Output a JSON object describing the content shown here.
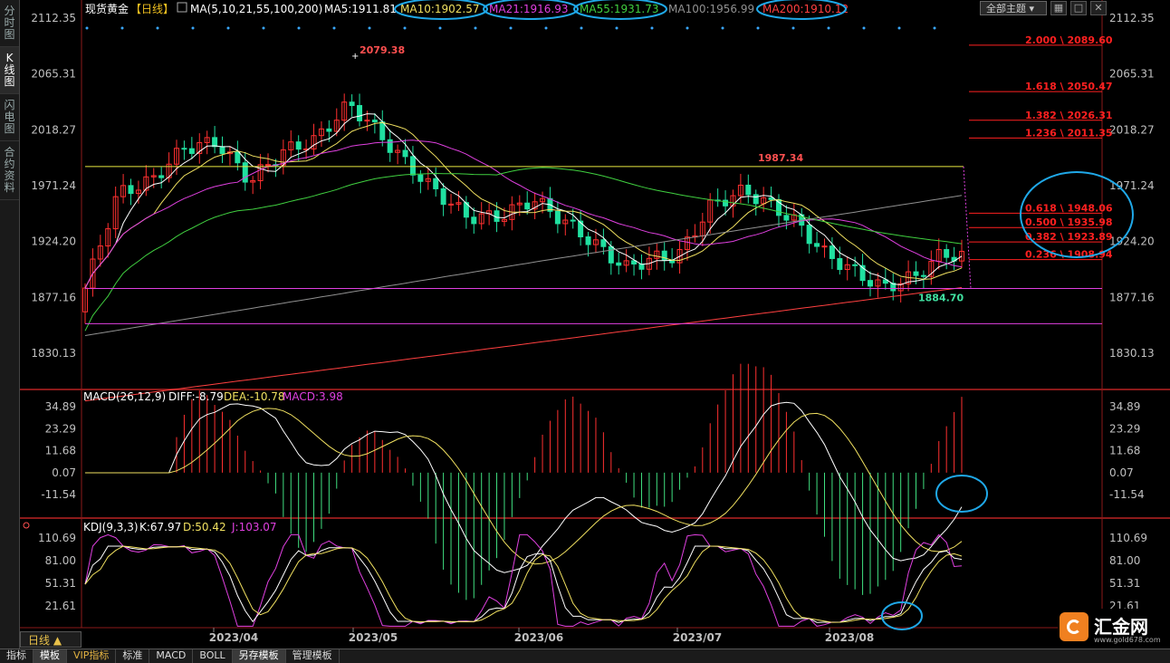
{
  "sidebar": {
    "tabs": [
      "分时图",
      "K线图",
      "闪电图",
      "合约资料"
    ],
    "active": 1
  },
  "header": {
    "symbol": "现货黄金",
    "period_tag": "【日线】",
    "ma_label": "MA(5,10,21,55,100,200)",
    "ma_values": [
      {
        "label": "MA5:1911.81",
        "color": "#ffffff",
        "highlighted": false
      },
      {
        "label": "MA10:1902.57",
        "color": "#f0e060",
        "highlighted": true
      },
      {
        "label": "MA21:1916.93",
        "color": "#e040e0",
        "highlighted": true
      },
      {
        "label": "MA55:1931.73",
        "color": "#40d040",
        "highlighted": true
      },
      {
        "label": "MA100:1956.99",
        "color": "#909090",
        "highlighted": false
      },
      {
        "label": "MA200:1910.12",
        "color": "#ff4040",
        "highlighted": true
      }
    ],
    "theme_select": "全部主题",
    "theme_icons": [
      "chevron-down-icon",
      "table-icon",
      "maximize-icon",
      "close-icon"
    ]
  },
  "price_axis": [
    "2112.35",
    "2065.31",
    "2018.27",
    "1971.24",
    "1924.20",
    "1877.16",
    "1830.13"
  ],
  "date_axis": [
    "2023/04",
    "2023/05",
    "2023/06",
    "2023/07",
    "2023/08"
  ],
  "annotations": {
    "high": "2079.38",
    "mid_high": "1987.34",
    "low": "1884.70"
  },
  "fib_levels": [
    {
      "label": "2.000 \\ 2089.60",
      "price": 2089.6
    },
    {
      "label": "1.618 \\ 2050.47",
      "price": 2050.47
    },
    {
      "label": "1.382 \\ 2026.31",
      "price": 2026.31
    },
    {
      "label": "1.236 \\ 2011.35",
      "price": 2011.35
    },
    {
      "label": "0.618 \\ 1948.06",
      "price": 1948.06
    },
    {
      "label": "0.500 \\ 1935.98",
      "price": 1935.98
    },
    {
      "label": "0.382 \\ 1923.89",
      "price": 1923.89
    },
    {
      "label": "0.236 \\ 1908.94",
      "price": 1908.94
    }
  ],
  "horizontal_lines": [
    {
      "price": 1987.34,
      "color": "#e8e840"
    },
    {
      "price": 1884.7,
      "color": "#e040e0"
    },
    {
      "price": 1855.0,
      "color": "#e040e0"
    }
  ],
  "macd": {
    "title": "MACD(26,12,9)",
    "diff": "DIFF:-8.79",
    "dea": "DEA:-10.78",
    "macd": "MACD:3.98",
    "axis": [
      "34.89",
      "23.29",
      "11.68",
      "0.07",
      "-11.54"
    ]
  },
  "kdj": {
    "title": "KDJ(9,3,3)",
    "k": "K:67.97",
    "d": "D:50.42",
    "j": "J:103.07",
    "axis": [
      "110.69",
      "81.00",
      "51.31",
      "21.61"
    ]
  },
  "period_selector": "日线 ▲",
  "bottom_tabs": [
    "指标",
    "模板",
    "VIP指标",
    "标准",
    "MACD",
    "BOLL",
    "另存模板",
    "管理模板"
  ],
  "bottom_active": [
    1,
    6
  ],
  "logo": {
    "text": "汇金网",
    "url": "www.gold678.com"
  },
  "colors": {
    "up": "#ff3030",
    "down": "#20e0a0",
    "ma5": "#ffffff",
    "ma10": "#f0e060",
    "ma21": "#e040e0",
    "ma55": "#40d040",
    "ma100": "#909090",
    "ma200": "#ff4040",
    "highlight_circle": "#1fa8e8",
    "fib": "#ff2020"
  }
}
